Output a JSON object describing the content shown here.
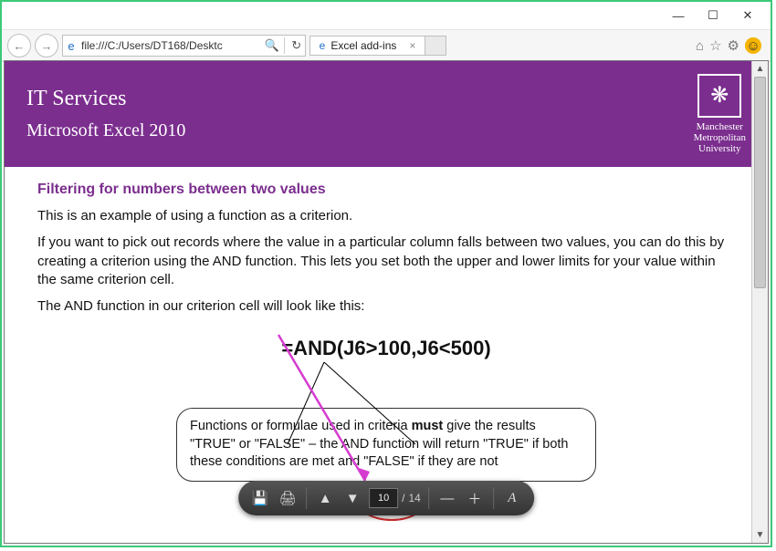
{
  "window": {
    "minimize": "—",
    "maximize": "☐",
    "close": "✕"
  },
  "nav": {
    "back": "←",
    "forward": "→",
    "url": "file:///C:/Users/DT168/Desktc",
    "search_icon": "🔍",
    "reload": "↻",
    "tab_label": "Excel add-ins",
    "tab_close": "×"
  },
  "toolbar_right": {
    "home": "⌂",
    "star": "☆",
    "gear": "⚙",
    "smiley": "☺"
  },
  "banner": {
    "title": "IT Services",
    "subtitle": "Microsoft Excel 2010",
    "uni_line1": "Manchester",
    "uni_line2": "Metropolitan",
    "uni_line3": "University",
    "logo_glyph": "❋"
  },
  "doc": {
    "heading": "Filtering for numbers between two values",
    "p1": "This is an example of using a function as a criterion.",
    "p2": "If you want to pick out records where the value in a particular column falls between two values, you can do this by creating a criterion using the AND function.  This lets you set both the upper and lower limits for your value within the same criterion cell.",
    "p3": "The AND function in our criterion cell will look like this:",
    "formula": "=AND(J6>100,J6<500)",
    "note_before": "Functions or formulae used in criteria ",
    "note_must": "must",
    "note_mid": " give the results \"TRUE\" or \"FALSE\" – the AND function will return \"TRUE\" if both these conditions are met and \"FALSE\" if they are not"
  },
  "pdfbar": {
    "save": "💾",
    "print": "🖨",
    "page_up": "▲",
    "page_down": "▼",
    "current_page": "10",
    "sep": "/",
    "total_pages": "14",
    "zoom_out": "—",
    "zoom_in": "＋",
    "adobe": "A"
  }
}
